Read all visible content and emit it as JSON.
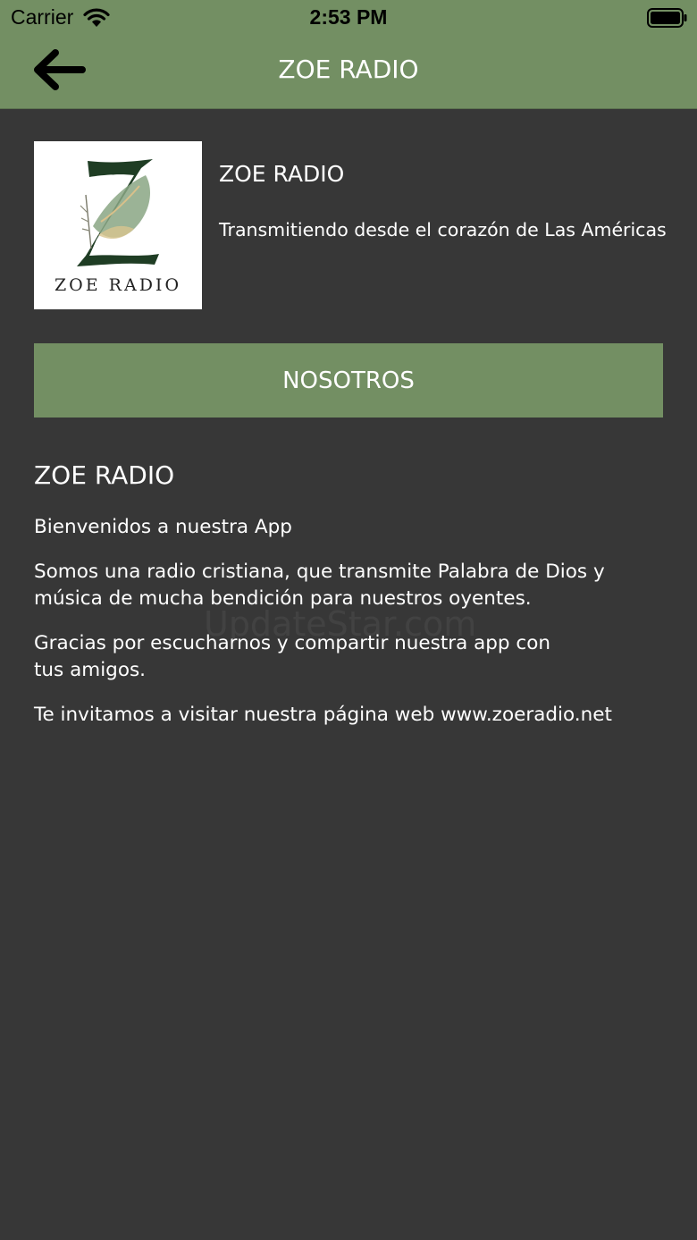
{
  "status_bar": {
    "carrier": "Carrier",
    "time": "2:53 PM"
  },
  "nav": {
    "title": "ZOE RADIO",
    "back_icon": "arrow-left-icon"
  },
  "station": {
    "logo_text": "ZOE RADIO",
    "name": "ZOE RADIO",
    "tagline": "Transmitiendo desde el corazón de Las Américas"
  },
  "section_button": {
    "label": "NOSOTROS"
  },
  "content": {
    "title": "ZOE RADIO",
    "paragraphs": [
      "Bienvenidos a nuestra App",
      "Somos una radio cristiana, que transmite Palabra de Dios y música de mucha bendición para nuestros oyentes.",
      "Gracias por escucharnos y compartir nuestra app con tus amigos.",
      "Te invitamos a visitar nuestra página web www.zoeradio.net"
    ]
  },
  "watermark": "UpdateStar.com",
  "colors": {
    "accent": "#738f63",
    "background": "#373737",
    "text": "#ffffff"
  }
}
